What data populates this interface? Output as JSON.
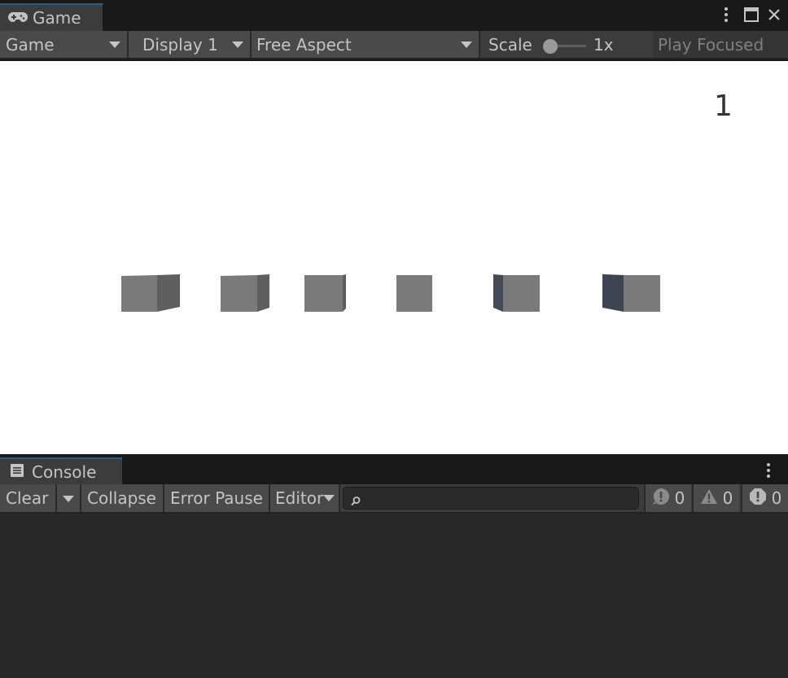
{
  "game_window": {
    "tab_label": "Game",
    "icons": {
      "tab": "gamepad-icon",
      "menu": "kebab-menu-icon",
      "maximize": "maximize-icon",
      "close": "close-icon"
    },
    "toolbar": {
      "view_dropdown": "Game",
      "display_dropdown": "Display 1",
      "aspect_dropdown": "Free Aspect",
      "scale_label": "Scale",
      "scale_value": "1x",
      "scale_slider_level": 0,
      "play_focused": "Play Focused"
    },
    "viewport": {
      "background": "#ffffff",
      "score_text": "1",
      "cube_count": 6,
      "cube_front_color": "#7a7a7a",
      "cube_side_color_gray": "#5c5c5c",
      "cube_side_color_dark": "#3e4652"
    }
  },
  "console_window": {
    "tab_label": "Console",
    "icons": {
      "tab": "console-icon",
      "menu": "kebab-menu-icon",
      "search": "search-icon",
      "info": "info-bubble-icon",
      "warning": "warning-icon",
      "error": "error-icon"
    },
    "toolbar": {
      "clear": "Clear",
      "collapse": "Collapse",
      "error_pause": "Error Pause",
      "editor": "Editor",
      "search_placeholder": "",
      "info_count": "0",
      "warning_count": "0",
      "error_count": "0"
    }
  },
  "colors": {
    "panel": "#3c3c3c",
    "tab_bar": "#191919",
    "button": "#4a4a4a",
    "text": "#c4c4c4",
    "accent": "#2c5d87"
  }
}
